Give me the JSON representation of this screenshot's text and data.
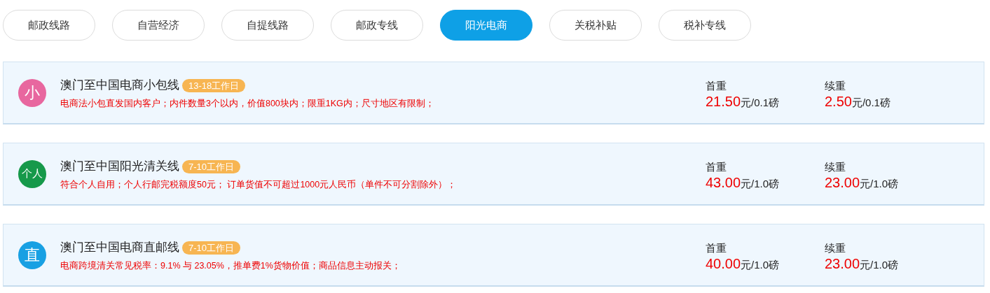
{
  "tabs": [
    {
      "label": "邮政线路",
      "selected": false
    },
    {
      "label": "自营经济",
      "selected": false
    },
    {
      "label": "自提线路",
      "selected": false
    },
    {
      "label": "邮政专线",
      "selected": false
    },
    {
      "label": "阳光电商",
      "selected": true
    },
    {
      "label": "关税补贴",
      "selected": false
    },
    {
      "label": "税补专线",
      "selected": false
    }
  ],
  "routes": [
    {
      "icon_text": "小",
      "color": "#e8679f",
      "title": "澳门至中国电商小包线",
      "badge": "13-18工作日",
      "description": "电商法小包直发国内客户；内件数量3个以内，价值800块内；限重1KG内；尺寸地区有限制；",
      "prices": [
        {
          "label": "首重",
          "amount": "21.50",
          "unit": "元/0.1磅"
        },
        {
          "label": "续重",
          "amount": "2.50",
          "unit": "元/0.1磅"
        }
      ]
    },
    {
      "icon_text": "个人",
      "color": "#16994a",
      "title": "澳门至中国阳光清关线",
      "badge": "7-10工作日",
      "description": "符合个人自用；个人行邮完税额度50元； 订单货值不可超过1000元人民币（单件不可分割除外）；",
      "prices": [
        {
          "label": "首重",
          "amount": "43.00",
          "unit": "元/1.0磅"
        },
        {
          "label": "续重",
          "amount": "23.00",
          "unit": "元/1.0磅"
        }
      ]
    },
    {
      "icon_text": "直",
      "color": "#18a0e3",
      "title": "澳门至中国电商直邮线",
      "badge": "7-10工作日",
      "description": "电商跨境清关常见税率：9.1% 与 23.05%，推单费1%货物价值；商品信息主动报关；",
      "prices": [
        {
          "label": "首重",
          "amount": "40.00",
          "unit": "元/1.0磅"
        },
        {
          "label": "续重",
          "amount": "23.00",
          "unit": "元/1.0磅"
        }
      ]
    }
  ]
}
